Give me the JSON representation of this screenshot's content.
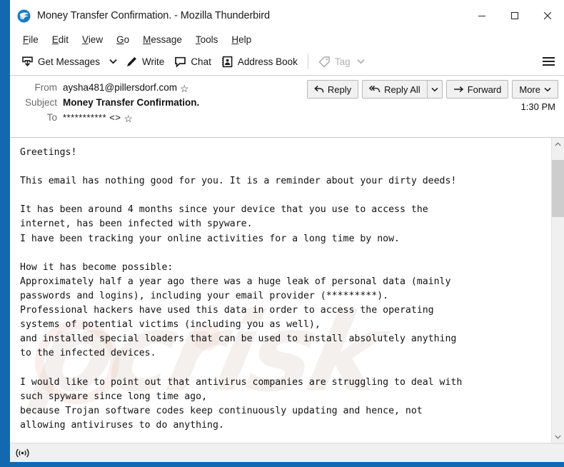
{
  "window": {
    "title": "Money Transfer Confirmation. - Mozilla Thunderbird",
    "app_icon": "thunderbird-icon",
    "controls": {
      "minimize": "minimize-icon",
      "maximize": "maximize-icon",
      "close": "close-icon"
    },
    "accent_blue": "#1269b0"
  },
  "menubar": {
    "items": [
      {
        "label": "File",
        "accel": "F"
      },
      {
        "label": "Edit",
        "accel": "E"
      },
      {
        "label": "View",
        "accel": "V"
      },
      {
        "label": "Go",
        "accel": "G"
      },
      {
        "label": "Message",
        "accel": "M"
      },
      {
        "label": "Tools",
        "accel": "T"
      },
      {
        "label": "Help",
        "accel": "H"
      }
    ]
  },
  "toolbar": {
    "get_messages": "Get Messages",
    "get_messages_icon": "get-messages-icon",
    "get_messages_caret": "chevron-down-icon",
    "write": "Write",
    "write_icon": "pencil-icon",
    "chat": "Chat",
    "chat_icon": "chat-bubble-icon",
    "address_book": "Address Book",
    "address_book_icon": "address-book-icon",
    "tag": "Tag",
    "tag_icon": "tag-icon",
    "tag_caret": "chevron-down-icon",
    "tag_disabled": true,
    "app_menu_icon": "hamburger-menu-icon"
  },
  "message": {
    "from_label": "From",
    "from_value": "aysha481@pillersdorf.com",
    "from_star_icon": "star-icon",
    "subject_label": "Subject",
    "subject_value": "Money Transfer Confirmation.",
    "to_label": "To",
    "to_value": "*********** <>",
    "to_star_icon": "star-icon",
    "timestamp": "1:30 PM",
    "actions": {
      "reply": "Reply",
      "reply_icon": "reply-arrow-icon",
      "reply_all": "Reply All",
      "reply_all_icon": "reply-all-arrow-icon",
      "reply_all_caret": "chevron-down-icon",
      "forward": "Forward",
      "forward_icon": "forward-arrow-icon",
      "more": "More",
      "more_caret": "chevron-down-icon"
    },
    "body": "Greetings!\n\nThis email has nothing good for you. It is a reminder about your dirty deeds!\n\nIt has been around 4 months since your device that you use to access the\ninternet, has been infected with spyware.\nI have been tracking your online activities for a long time by now.\n\nHow it has become possible:\nApproximately half a year ago there was a huge leak of personal data (mainly\npasswords and logins), including your email provider (*********).\nProfessional hackers have used this data in order to access the operating\nsystems of potential victims (including you as well),\nand installed special loaders that can be used to install absolutely anything\nto the infected devices.\n\nI would like to point out that antivirus companies are struggling to deal with\nsuch spyware since long time ago,\nbecause Trojan software codes keep continuously updating and hence, not\nallowing antiviruses to do anything.",
    "watermark_text": "pcrisk"
  },
  "scrollbar": {
    "up_arrow_icon": "chevron-up-icon",
    "down_arrow_icon": "chevron-down-icon",
    "thumb": "scrollbar-thumb"
  },
  "statusbar": {
    "icon": "broadcast-icon",
    "message": ""
  }
}
